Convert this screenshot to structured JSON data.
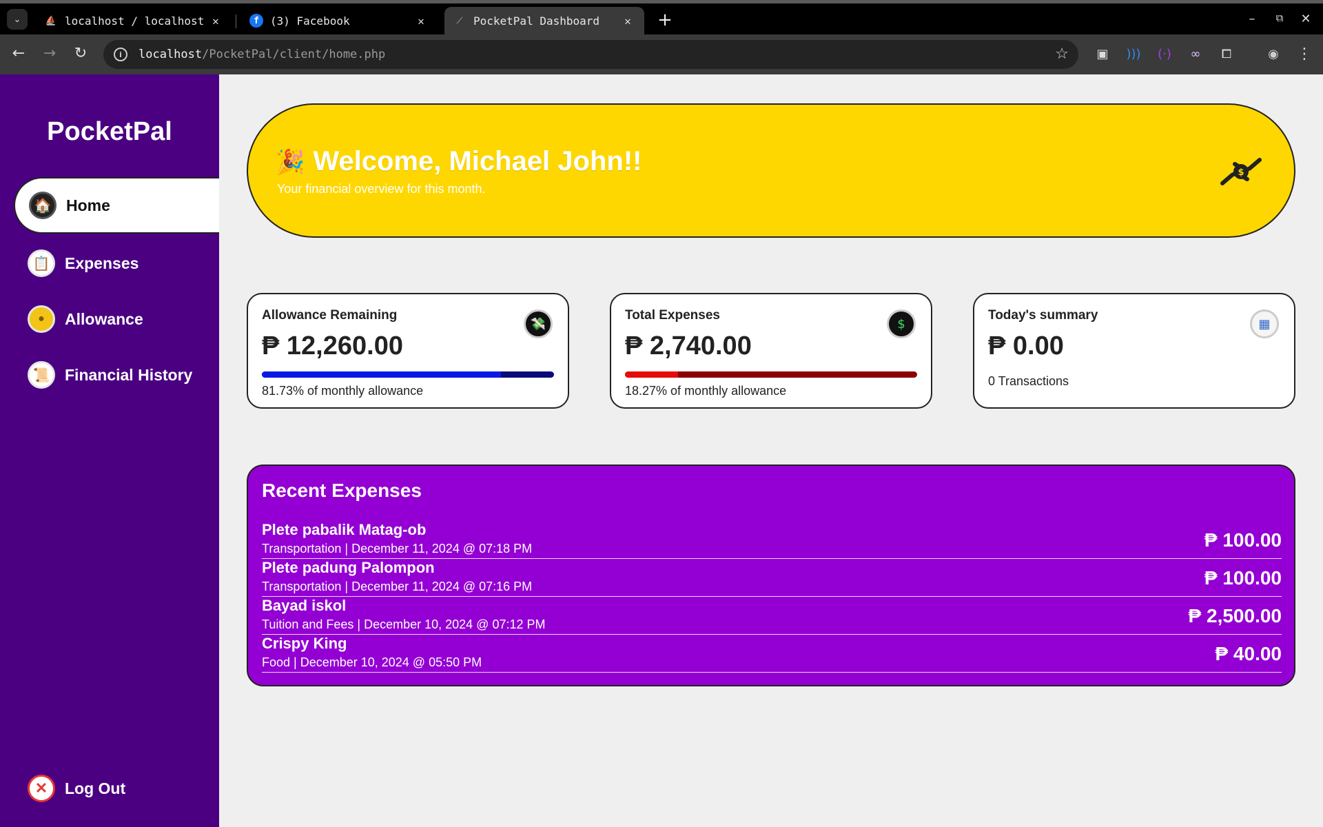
{
  "browser": {
    "tabs": [
      {
        "title": "localhost / localhost",
        "favicon": "phpmyadmin-icon"
      },
      {
        "title": "(3) Facebook",
        "favicon": "facebook-icon"
      },
      {
        "title": "PocketPal Dashboard",
        "favicon": "pocketpal-icon"
      }
    ],
    "url_host": "localhost",
    "url_path": "/PocketPal/client/home.php"
  },
  "app": {
    "brand": "PocketPal",
    "nav": [
      {
        "label": "Home",
        "icon": "house-icon"
      },
      {
        "label": "Expenses",
        "icon": "clipboard-icon"
      },
      {
        "label": "Allowance",
        "icon": "coin-icon"
      },
      {
        "label": "Financial History",
        "icon": "scroll-icon"
      }
    ],
    "logout": "Log Out"
  },
  "welcome": {
    "title": "Welcome, Michael John!!",
    "subtitle": "Your financial overview for this month."
  },
  "cards": [
    {
      "title": "Allowance Remaining",
      "value": "₱ 12,260.00",
      "note": "81.73% of monthly allowance",
      "progress": 0.8173,
      "fill_color": "#0a1ae6",
      "track_color": "#0a0a7a"
    },
    {
      "title": "Total Expenses",
      "value": "₱ 2,740.00",
      "note": "18.27% of monthly allowance",
      "progress": 0.1827,
      "fill_color": "#e60a0a",
      "track_color": "#8b0000"
    },
    {
      "title": "Today's summary",
      "value": "₱ 0.00",
      "note": "0 Transactions"
    }
  ],
  "recent": {
    "title": "Recent Expenses",
    "rows": [
      {
        "name": "Plete pabalik Matag-ob",
        "meta": "Transportation | December 11, 2024 @ 07:18 PM",
        "amount": "₱ 100.00"
      },
      {
        "name": "Plete padung Palompon",
        "meta": "Transportation | December 11, 2024 @ 07:16 PM",
        "amount": "₱ 100.00"
      },
      {
        "name": "Bayad iskol",
        "meta": "Tuition and Fees | December 10, 2024 @ 07:12 PM",
        "amount": "₱ 2,500.00"
      },
      {
        "name": "Crispy King",
        "meta": "Food | December 10, 2024 @ 05:50 PM",
        "amount": "₱ 40.00"
      }
    ]
  },
  "colors": {
    "sidebar": "#4b0082",
    "banner": "#ffd700",
    "recent_panel": "#9400d3"
  }
}
